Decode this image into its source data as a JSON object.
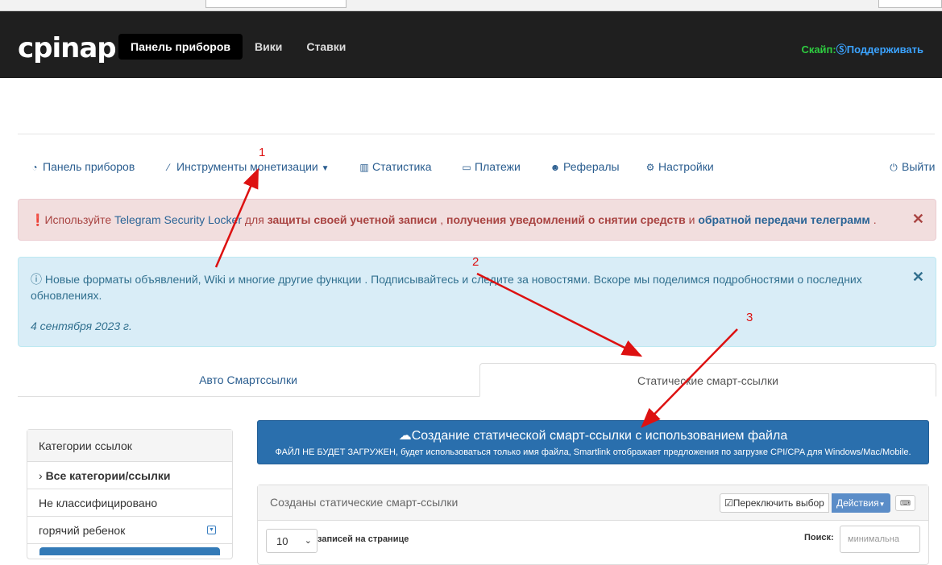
{
  "topbar": {
    "logo": "cpinap",
    "nav": [
      "Панель приборов",
      "Вики",
      "Ставки"
    ],
    "skype": "Скайп:",
    "support": "Поддерживать"
  },
  "mainnav": {
    "dashboard": "Панель приборов",
    "tools": "Инструменты монетизации",
    "stats": "Статистика",
    "payments": "Платежи",
    "referrals": "Рефералы",
    "settings": "Настройки",
    "logout": "Выйти"
  },
  "alert_red": {
    "prefix": "Используйте",
    "link": "Telegram Security Locker",
    "mid1": "для",
    "bold1": "защиты своей учетной записи",
    "sep": ",",
    "bold2": "получения уведомлений о снятии средств",
    "and": "и",
    "link2": "обратной передачи телеграмм",
    "end": "."
  },
  "alert_blue": {
    "text": "Новые форматы объявлений, Wiki и многие другие функции . Подписывайтесь и следите за новостями. Вскоре мы поделимся подробностями о последних обновлениях.",
    "date": "4 сентября 2023 г."
  },
  "tabs": [
    "Авто Смартссылки",
    "Статические смарт-ссылки"
  ],
  "sidebar": {
    "title": "Категории ссылок",
    "items": [
      "Все категории/ссылки",
      "Не классифицировано",
      "горячий ребенок"
    ]
  },
  "create": {
    "title": "Создание статической смарт-ссылки с использованием файла",
    "subtitle": "ФАЙЛ НЕ БУДЕТ ЗАГРУЖЕН, будет использоваться только имя файла, Smartlink отображает предложения по загрузке CPI/CPA для Windows/Mac/Mobile."
  },
  "panel": {
    "title": "Созданы статические смарт-ссылки",
    "toggle": "Переключить выбор",
    "actions": "Действия",
    "per_page_value": "10",
    "per_page_label": "записей на странице",
    "search_label": "Поиск:",
    "search_placeholder": "минимальна"
  },
  "annotations": [
    "1",
    "2",
    "3"
  ],
  "colors": {
    "arrow": "#dd1111",
    "topbar": "#1f1f1f",
    "primary": "#2a6fad"
  }
}
